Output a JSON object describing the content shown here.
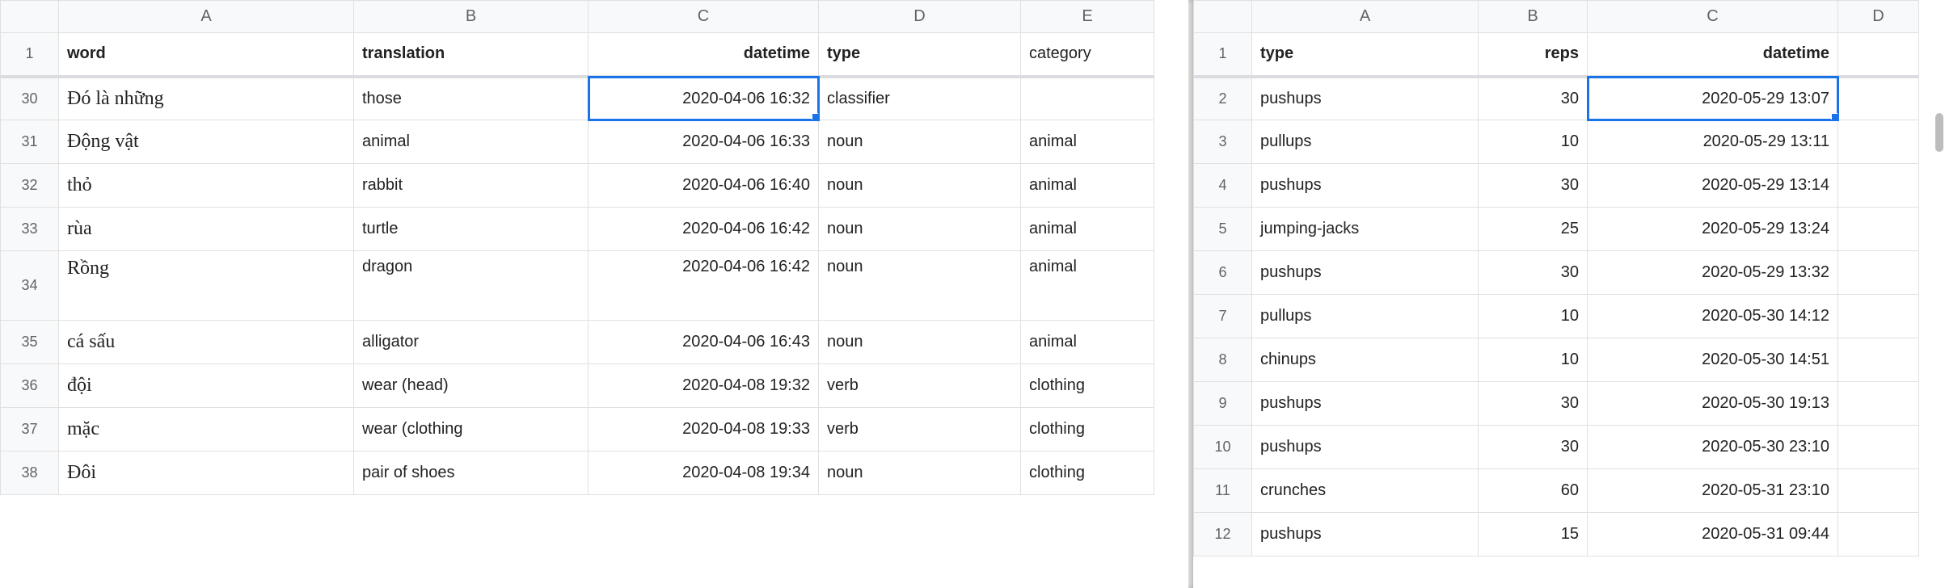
{
  "left": {
    "columns": [
      "A",
      "B",
      "C",
      "D",
      "E"
    ],
    "headers": {
      "A": "word",
      "B": "translation",
      "C": "datetime",
      "D": "type",
      "E": "category"
    },
    "headerRowNum": "1",
    "selected": {
      "row": 30,
      "col": "C"
    },
    "rows": [
      {
        "num": "30",
        "A": "Đó là những",
        "B": "those",
        "C": "2020-04-06 16:32",
        "D": "classifier",
        "E": ""
      },
      {
        "num": "31",
        "A": "Động vật",
        "B": "animal",
        "C": "2020-04-06 16:33",
        "D": "noun",
        "E": "animal"
      },
      {
        "num": "32",
        "A": "thỏ",
        "B": "rabbit",
        "C": "2020-04-06 16:40",
        "D": "noun",
        "E": "animal"
      },
      {
        "num": "33",
        "A": "rùa",
        "B": "turtle",
        "C": "2020-04-06 16:42",
        "D": "noun",
        "E": "animal"
      },
      {
        "num": "34",
        "A": "Rồng",
        "B": "dragon",
        "C": "2020-04-06 16:42",
        "D": "noun",
        "E": "animal",
        "tall": true
      },
      {
        "num": "35",
        "A": "cá sấu",
        "B": "alligator",
        "C": "2020-04-06 16:43",
        "D": "noun",
        "E": "animal"
      },
      {
        "num": "36",
        "A": "đội",
        "B": "wear (head)",
        "C": "2020-04-08 19:32",
        "D": "verb",
        "E": "clothing"
      },
      {
        "num": "37",
        "A": "mặc",
        "B": "wear (clothing",
        "C": "2020-04-08 19:33",
        "D": "verb",
        "E": "clothing"
      },
      {
        "num": "38",
        "A": "Đôi",
        "B": "pair of shoes",
        "C": "2020-04-08 19:34",
        "D": "noun",
        "E": "clothing"
      }
    ],
    "colWidths": {
      "A": 365,
      "B": 290,
      "C": 285,
      "D": 250,
      "E": 165
    }
  },
  "right": {
    "columns": [
      "A",
      "B",
      "C",
      "D"
    ],
    "headers": {
      "A": "type",
      "B": "reps",
      "C": "datetime",
      "D": ""
    },
    "headerRowNum": "1",
    "selected": {
      "row": 2,
      "col": "C"
    },
    "rows": [
      {
        "num": "2",
        "A": "pushups",
        "B": "30",
        "C": "2020-05-29 13:07"
      },
      {
        "num": "3",
        "A": "pullups",
        "B": "10",
        "C": "2020-05-29 13:11"
      },
      {
        "num": "4",
        "A": "pushups",
        "B": "30",
        "C": "2020-05-29 13:14"
      },
      {
        "num": "5",
        "A": "jumping-jacks",
        "B": "25",
        "C": "2020-05-29 13:24"
      },
      {
        "num": "6",
        "A": "pushups",
        "B": "30",
        "C": "2020-05-29 13:32"
      },
      {
        "num": "7",
        "A": "pullups",
        "B": "10",
        "C": "2020-05-30 14:12"
      },
      {
        "num": "8",
        "A": "chinups",
        "B": "10",
        "C": "2020-05-30 14:51"
      },
      {
        "num": "9",
        "A": "pushups",
        "B": "30",
        "C": "2020-05-30 19:13"
      },
      {
        "num": "10",
        "A": "pushups",
        "B": "30",
        "C": "2020-05-30 23:10"
      },
      {
        "num": "11",
        "A": "crunches",
        "B": "60",
        "C": "2020-05-31 23:10"
      },
      {
        "num": "12",
        "A": "pushups",
        "B": "15",
        "C": "2020-05-31 09:44"
      }
    ],
    "colWidths": {
      "A": 280,
      "B": 135,
      "C": 310,
      "D": 100
    }
  }
}
